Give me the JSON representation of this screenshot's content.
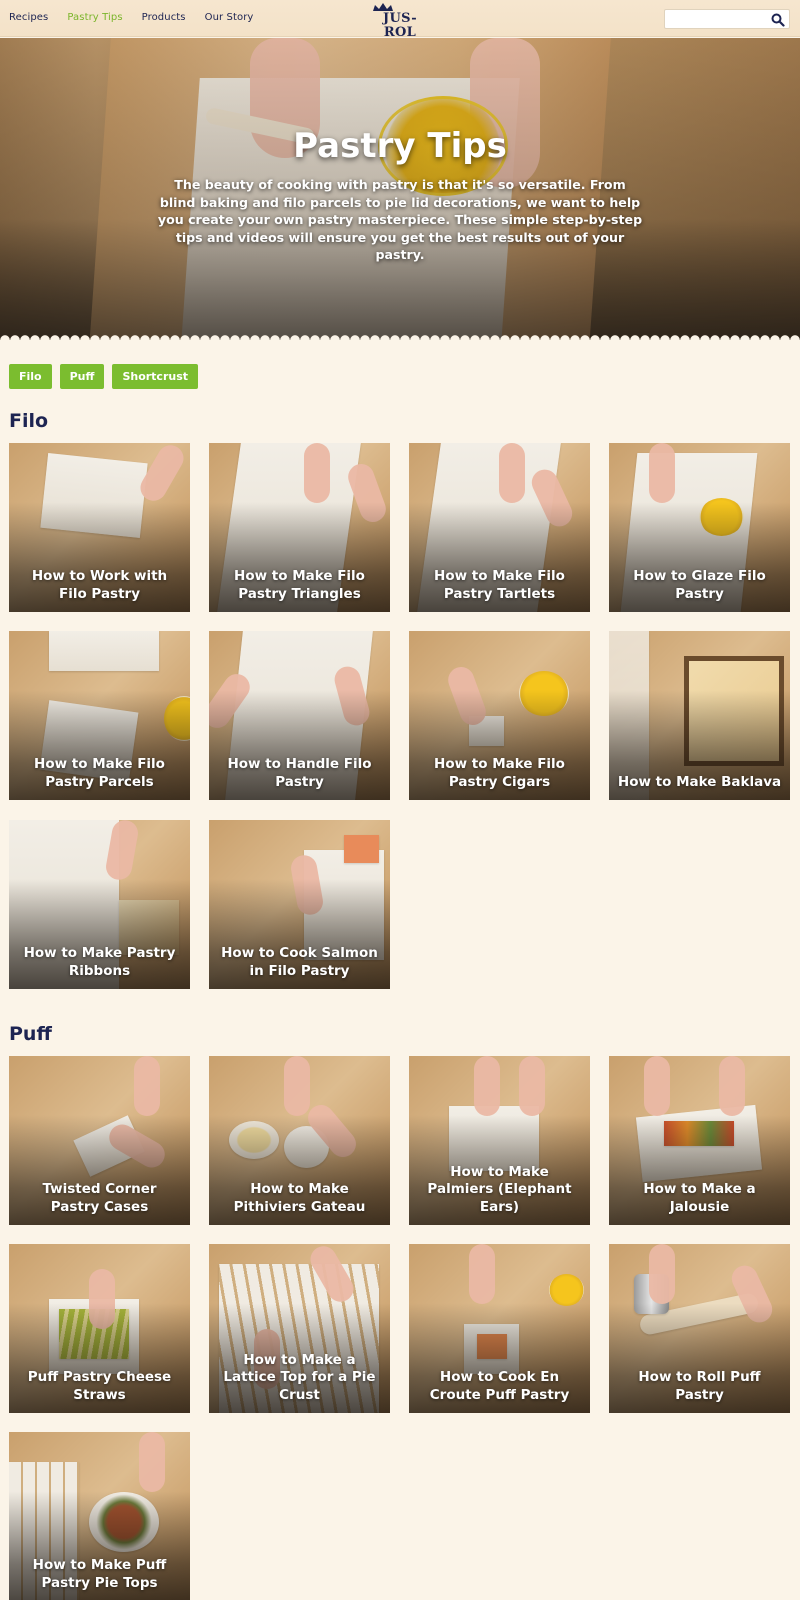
{
  "header": {
    "nav": [
      "Recipes",
      "Pastry Tips",
      "Products",
      "Our Story"
    ],
    "active_nav": "Pastry Tips",
    "logo_text": "JUS-ROL",
    "search": {
      "value": "",
      "placeholder": ""
    }
  },
  "hero": {
    "title": "Pastry Tips",
    "description": "The beauty of cooking with pastry is that it's so versatile. From blind baking and filo parcels to pie lid decorations, we want to help you create your own pastry masterpiece. These simple step-by-step tips and videos will ensure you get the best results out of your pastry."
  },
  "filters": [
    "Filo",
    "Puff",
    "Shortcrust"
  ],
  "colors": {
    "accent": "#7bbd2f",
    "navy": "#1d2452",
    "background": "#fbf4e8"
  },
  "sections": [
    {
      "heading": "Filo",
      "cards": [
        "How to Work with Filo Pastry",
        "How to Make Filo Pastry Triangles",
        "How to Make Filo Pastry Tartlets",
        "How to Glaze Filo Pastry",
        "How to Make Filo Pastry Parcels",
        "How to Handle Filo Pastry",
        "How to Make Filo Pastry Cigars",
        "How to Make Baklava",
        "How to Make Pastry Ribbons",
        "How to Cook Salmon in Filo Pastry"
      ]
    },
    {
      "heading": "Puff",
      "cards": [
        "Twisted Corner Pastry Cases",
        "How to Make Pithiviers Gateau",
        "How to Make Palmiers (Elephant Ears)",
        "How to Make a Jalousie",
        "Puff Pastry Cheese Straws",
        "How to Make a Lattice Top for a Pie Crust",
        "How to Cook En Croute Puff Pastry",
        "How to Roll Puff Pastry",
        "How to Make Puff Pastry Pie Tops"
      ]
    }
  ]
}
